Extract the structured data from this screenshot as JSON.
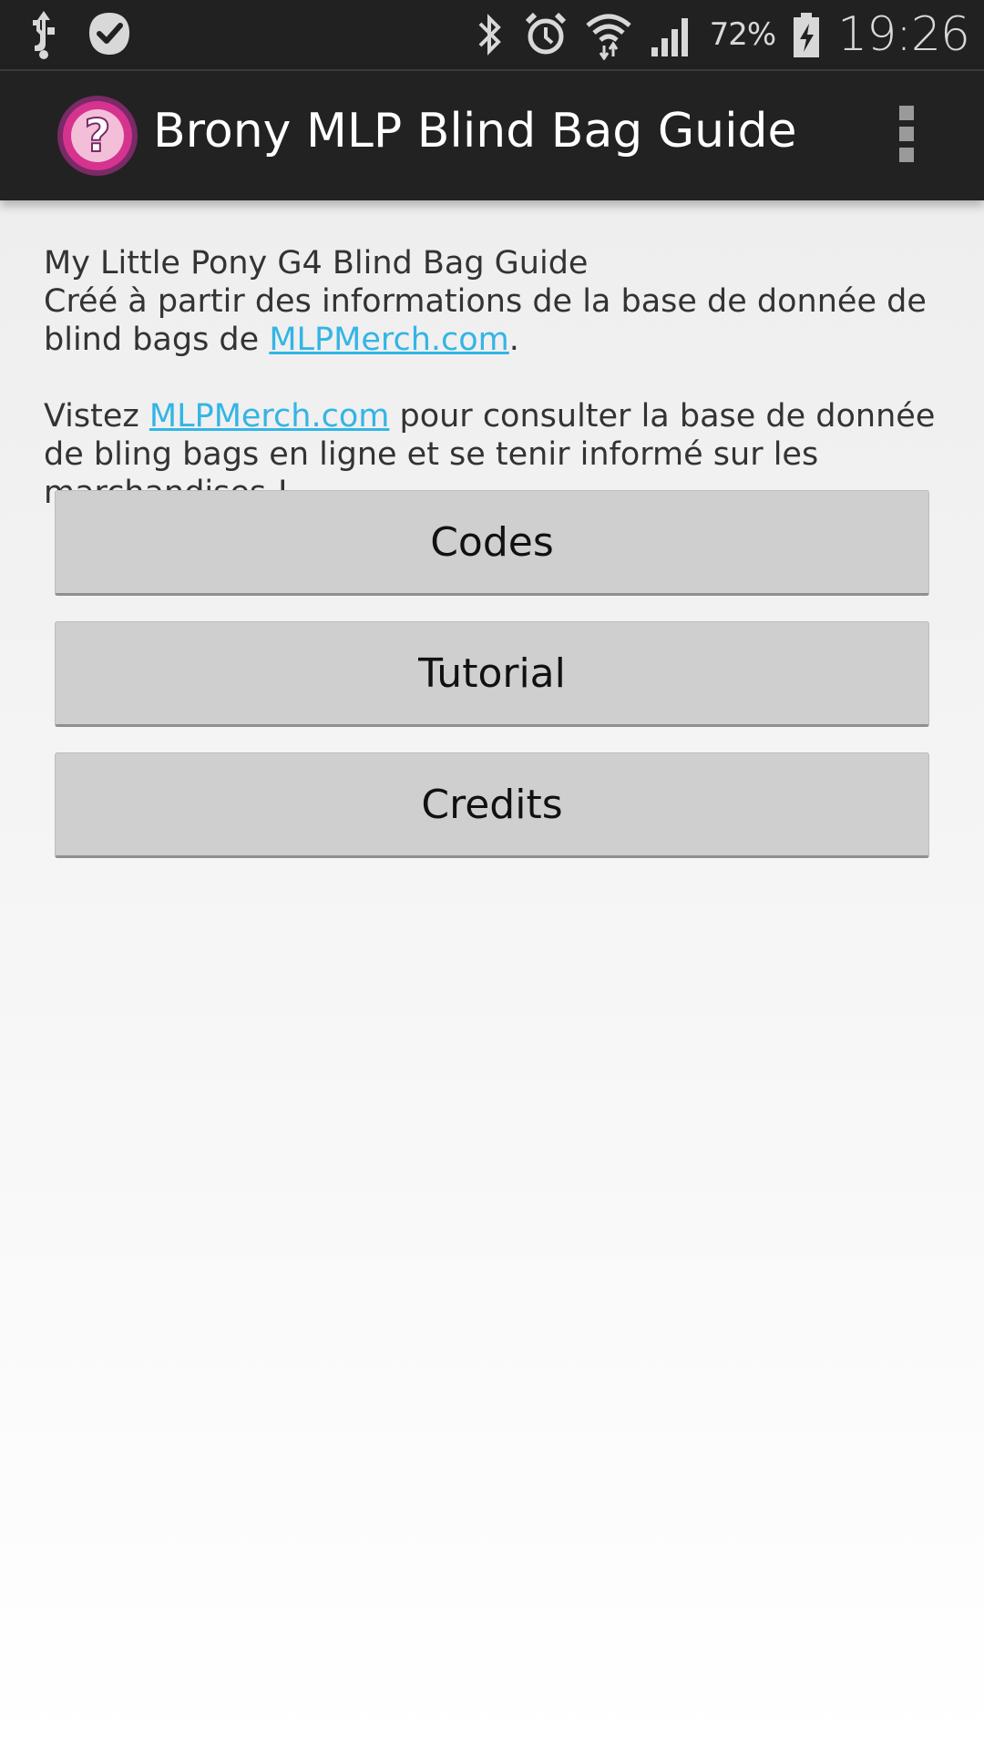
{
  "status_bar": {
    "icons": [
      "usb-icon",
      "checkmark-badge-icon",
      "bluetooth-icon",
      "alarm-icon",
      "wifi-icon",
      "signal-icon",
      "battery-charging-icon"
    ],
    "battery_percent": "72%",
    "time": "19:26"
  },
  "action_bar": {
    "app_icon": "question-mark-icon",
    "title": "Brony MLP Blind Bag Guide",
    "menu_icon": "overflow-menu-icon",
    "accent_color": "#d6338f"
  },
  "intro": {
    "line1": "My Little Pony G4 Blind Bag Guide",
    "line2_prefix": "Créé à partir des informations de la base de donnée de blind bags de ",
    "link1": "MLPMerch.com",
    "line2_suffix": ".",
    "line3_prefix": "Vistez ",
    "link2": "MLPMerch.com",
    "line3_suffix": " pour consulter la base de donnée de bling bags en ligne et se tenir informé sur les marchandises !",
    "link_color": "#33b5e5"
  },
  "buttons": {
    "codes": "Codes",
    "tutorial": "Tutorial",
    "credits": "Credits"
  }
}
